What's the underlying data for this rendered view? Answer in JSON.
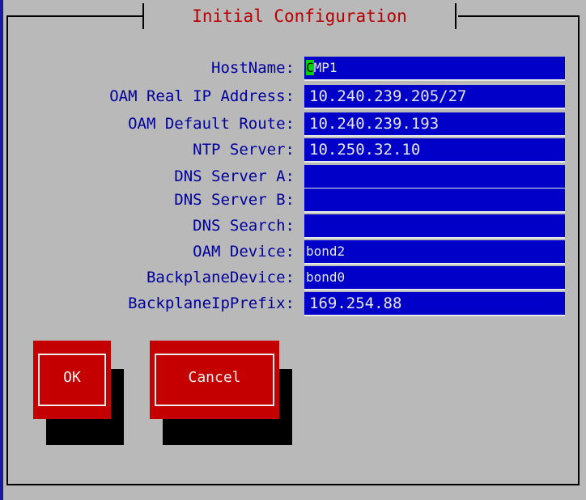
{
  "dialog": {
    "title": "Initial Configuration"
  },
  "fields": [
    {
      "label": "HostName:",
      "cursor_char": "C",
      "value": "MP1"
    },
    {
      "label": "OAM Real IP Address:",
      "value": "10.240.239.205/27"
    },
    {
      "label": "OAM Default Route:",
      "value": "10.240.239.193"
    },
    {
      "label": "NTP Server:",
      "value": "10.250.32.10"
    },
    {
      "label": "DNS Server A:",
      "value": ""
    },
    {
      "label": "DNS Server B:",
      "value": ""
    },
    {
      "label": "DNS Search:",
      "value": ""
    },
    {
      "label": "OAM Device:",
      "value": "bond2"
    },
    {
      "label": "BackplaneDevice:",
      "value": "bond0"
    },
    {
      "label": "BackplaneIpPrefix:",
      "value": "169.254.88"
    }
  ],
  "buttons": {
    "ok_label": "OK",
    "cancel_label": "Cancel"
  },
  "colors": {
    "background": "#b9b9b9",
    "title": "#b80000",
    "label": "#00009c",
    "field_bg": "#0000c8",
    "field_text": "#e6e6e6",
    "cursor": "#00d400",
    "button": "#c40000"
  }
}
